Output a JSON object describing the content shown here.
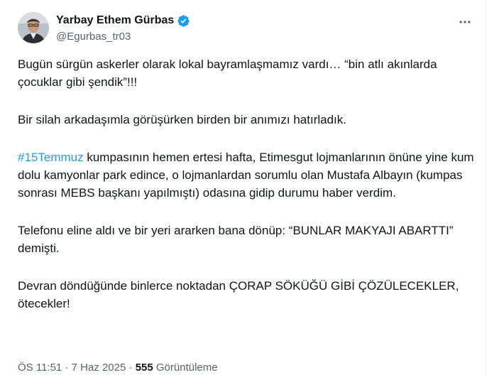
{
  "author": {
    "display_name": "Yarbay Ethem Gürbas",
    "handle": "@Egurbas_tr03",
    "verified": true,
    "verified_color": "#1d9bf0"
  },
  "more_icon": "more-horizontal-icon",
  "tweet": {
    "p1": "Bugün sürgün askerler olarak lokal bayramlaşmamız vardı… “bin atlı akınlarda çocuklar gibi şendik”!!!",
    "p2": "Bir silah arkadaşımla görüşürken birden bir anımızı hatırladık.",
    "p3_hashtag": "#15Temmuz",
    "p3_rest": " kumpasının hemen ertesi hafta, Etimesgut lojmanlarının önüne yine kum dolu kamyonlar park edince, o lojmanlardan sorumlu olan Mustafa Albayın (kumpas sonrası MEBS başkanı yapılmıştı) odasına gidip durumu haber verdim.",
    "p4": "Telefonu eline aldı ve bir yeri ararken bana dönüp: “BUNLAR MAKYAJI ABARTTI” demişti.",
    "p5": "Devran döndüğünde binlerce noktadan ÇORAP SÖKÜĞÜ GİBİ ÇÖZÜLECEKLER, ötecekler!"
  },
  "meta": {
    "time": "ÖS 11:51",
    "separator": "·",
    "date": "7 Haz 2025",
    "views_count": "555",
    "views_label": "Görüntüleme"
  },
  "colors": {
    "text": "#0f1419",
    "secondary": "#536471",
    "accent": "#1d9bf0"
  }
}
